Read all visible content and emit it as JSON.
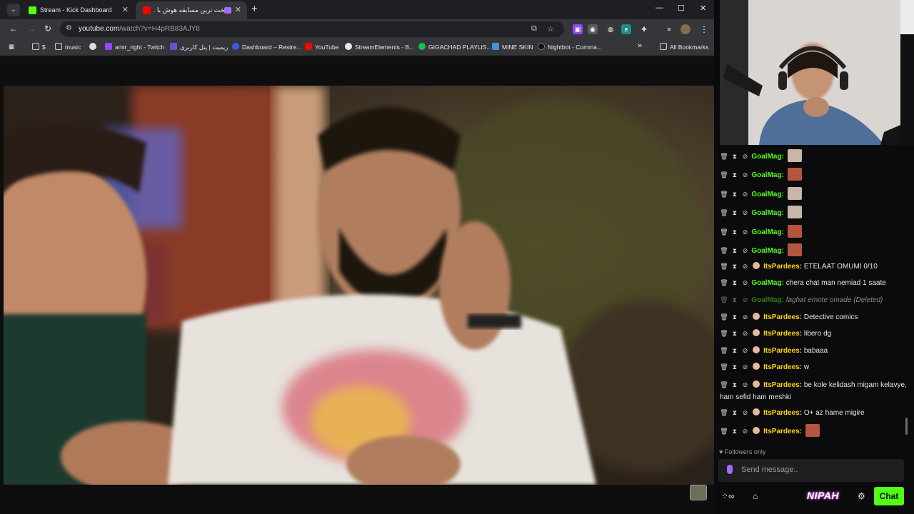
{
  "browser": {
    "tabs": [
      {
        "title": "Stream - Kick Dashboard",
        "active": false,
        "favicon_color": "#53fc18"
      },
      {
        "title": "سخت ترین مسابقه هوش با ...",
        "active": true,
        "favicon_color": "#ff0000"
      }
    ],
    "tab_menu_icon": "chevron-down-icon",
    "new_tab_label": "+",
    "window_controls": {
      "minimize": "—",
      "maximize": "☐",
      "close": "✕"
    },
    "nav": {
      "back": "←",
      "forward": "→",
      "reload": "↻"
    },
    "url": {
      "host": "youtube.com",
      "path": "/watch?v=H4pRB83AJY8"
    },
    "omnibox_icons": {
      "cast": "⧉",
      "star": "☆"
    },
    "more_menu": "⋮",
    "bookmarks": [
      {
        "label": "",
        "icon": "apps-grid-icon"
      },
      {
        "label": "$",
        "icon": "folder-icon"
      },
      {
        "label": "music",
        "icon": "folder-icon"
      },
      {
        "label": "",
        "icon": "chrome-icon"
      },
      {
        "label": "amir_right - Twitch",
        "icon": "twitch-icon"
      },
      {
        "label": "ریمیت | پنل کاربری",
        "icon": "remit-icon"
      },
      {
        "label": "Dashboard – Restre...",
        "icon": "restream-icon"
      },
      {
        "label": "YouTube",
        "icon": "youtube-icon"
      },
      {
        "label": "StreamElements - B...",
        "icon": "streamelements-icon"
      },
      {
        "label": "GIGACHAD PLAYLIS...",
        "icon": "spotify-icon"
      },
      {
        "label": "MINE SKIN",
        "icon": "mineskin-icon"
      },
      {
        "label": "Nightbot - Comma...",
        "icon": "nightbot-icon"
      }
    ],
    "bookmarks_overflow": "»",
    "all_bookmarks": "All Bookmarks"
  },
  "chat": {
    "messages": [
      {
        "user": "GoalMag",
        "text": "",
        "emote": "#c9b6a6",
        "color": "green",
        "deleted": false
      },
      {
        "user": "GoalMag",
        "text": "",
        "emote": "#b4553f",
        "color": "green",
        "deleted": false
      },
      {
        "user": "GoalMag",
        "text": "",
        "emote": "#c9b6a6",
        "color": "green",
        "deleted": false
      },
      {
        "user": "GoalMag",
        "text": "",
        "emote": "#c9b6a6",
        "color": "green",
        "deleted": false
      },
      {
        "user": "GoalMag",
        "text": "",
        "emote": "#b4553f",
        "color": "green",
        "deleted": false
      },
      {
        "user": "GoalMag",
        "text": "",
        "emote": "#b4553f",
        "color": "green",
        "deleted": false
      },
      {
        "user": "ItsPardees",
        "text": "ETELAAT OMUMI 0/10",
        "emote": "",
        "color": "yellow",
        "deleted": false
      },
      {
        "user": "GoalMag",
        "text": "chera chat man nemiad 1 saate",
        "emote": "",
        "color": "green",
        "deleted": false
      },
      {
        "user": "GoalMag",
        "text": "faghat emote omade (Deleted)",
        "emote": "",
        "color": "green",
        "deleted": true
      },
      {
        "user": "ItsPardees",
        "text": "Detective comics",
        "emote": "",
        "color": "yellow",
        "deleted": false
      },
      {
        "user": "ItsPardees",
        "text": "libero dg",
        "emote": "",
        "color": "yellow",
        "deleted": false
      },
      {
        "user": "ItsPardees",
        "text": "babaaa",
        "emote": "",
        "color": "yellow",
        "deleted": false
      },
      {
        "user": "ItsPardees",
        "text": "w",
        "emote": "",
        "color": "yellow",
        "deleted": false
      },
      {
        "user": "ItsPardees",
        "text": "be kole kelidash migam kelavye, ham sefid ham meshki",
        "emote": "",
        "color": "yellow",
        "deleted": false
      },
      {
        "user": "ItsPardees",
        "text": "O+ az hame migire",
        "emote": "",
        "color": "yellow",
        "deleted": false
      },
      {
        "user": "ItsPardees",
        "text": "",
        "emote": "#b4553f",
        "color": "yellow",
        "deleted": false
      }
    ],
    "followers_only": "Followers only",
    "input_placeholder": "Send message..",
    "nipah_label": "NIPAH",
    "chat_button": "Chat"
  }
}
